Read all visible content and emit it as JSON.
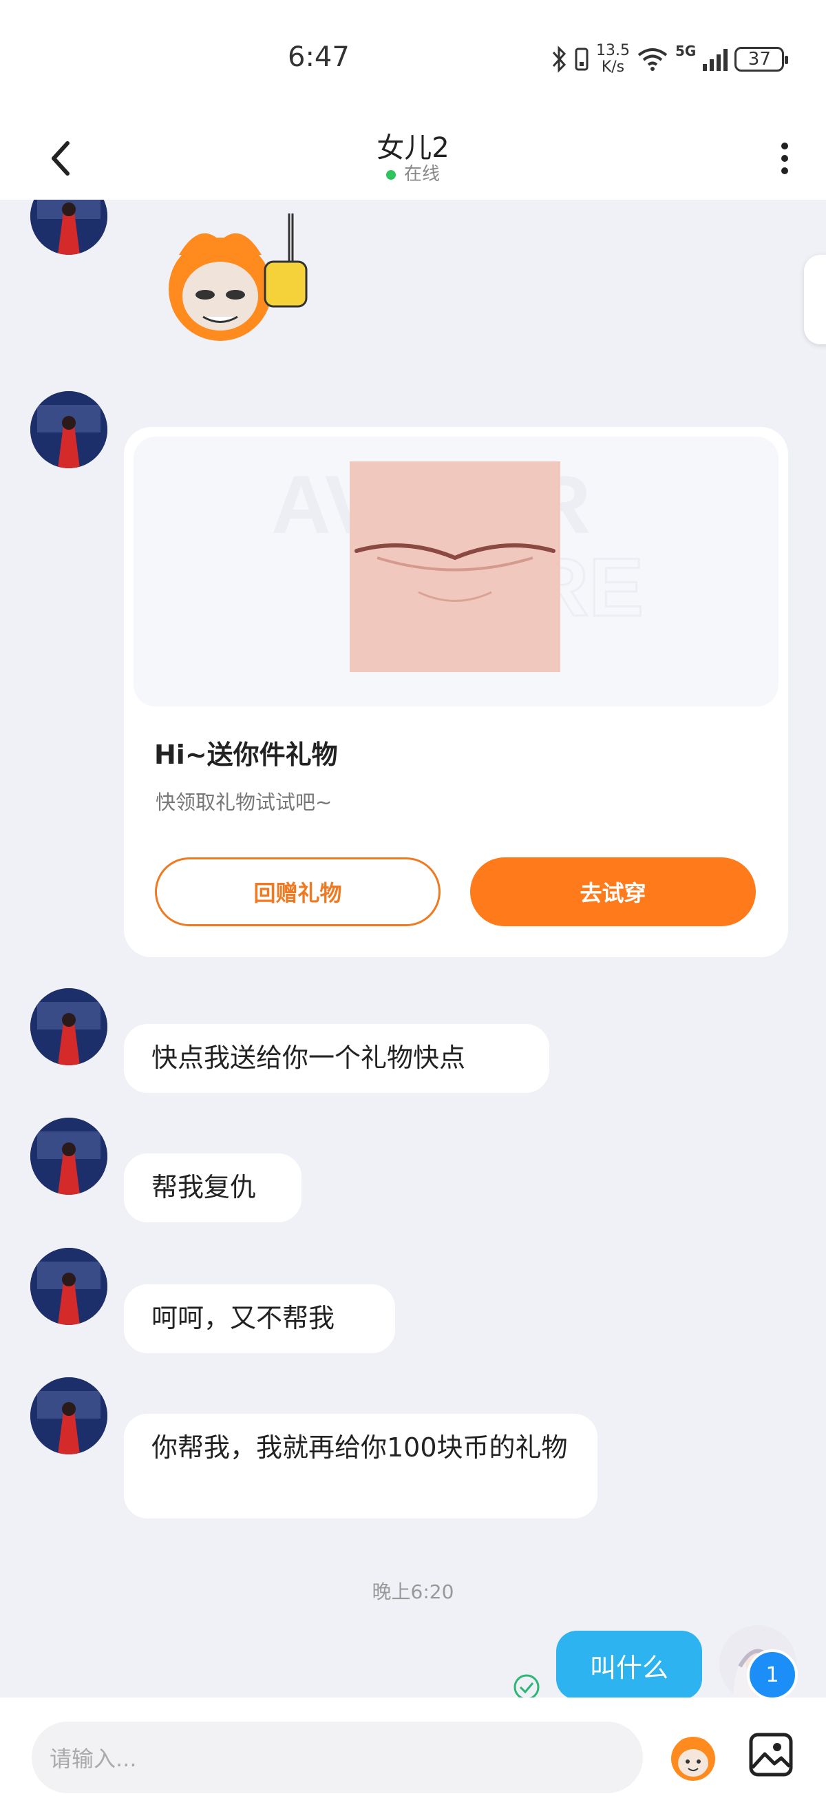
{
  "status_bar": {
    "time": "6:47",
    "net_speed_value": "13.5",
    "net_speed_unit": "K/s",
    "network": "5G",
    "battery": "37"
  },
  "header": {
    "title": "女儿2",
    "status": "在线"
  },
  "gift_card": {
    "title": "Hi~送你件礼物",
    "subtitle": "快领取礼物试试吧~",
    "return_button": "回赠礼物",
    "try_button": "去试穿"
  },
  "messages": [
    {
      "text": "快点我送给你一个礼物快点"
    },
    {
      "text": "帮我复仇"
    },
    {
      "text": "呵呵，又不帮我"
    },
    {
      "text": "你帮我，我就再给你100块币的礼物"
    }
  ],
  "timestamp": "晚上6:20",
  "my_message": "叫什么",
  "unread_badge": "1",
  "input": {
    "placeholder": "请输入..."
  },
  "colors": {
    "accent_orange": "#ff7a1a",
    "my_bubble": "#2db4f0",
    "online_dot": "#2fc45c"
  }
}
